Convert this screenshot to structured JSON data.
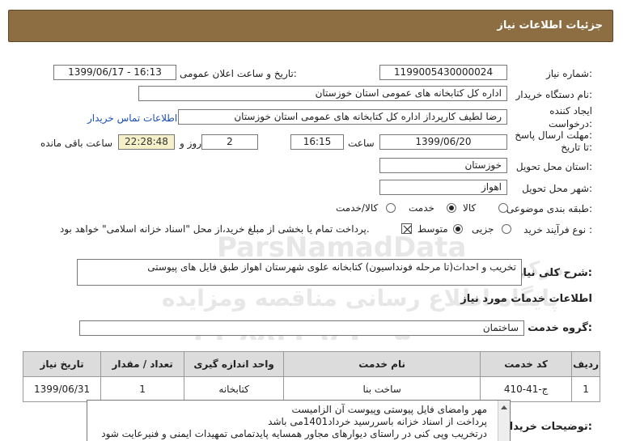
{
  "header": {
    "title": "جزئیات اطلاعات نیاز"
  },
  "fields": {
    "need_number_label": "شماره نیاز:",
    "need_number": "1199005430000024",
    "announce_label": "تاریخ و ساعت اعلان عمومی:",
    "announce_value": "1399/06/17 - 16:13",
    "buyer_label": "نام دستگاه خریدار:",
    "buyer_value": "اداره کل کتابخانه های عمومی استان خوزستان",
    "creator_label_1": "ایجاد کننده",
    "creator_label_2": "درخواست:",
    "creator_value": "رضا لطیف کارپرداز اداره کل کتابخانه های عمومی استان خوزستان",
    "contact_link": "اطلاعات تماس خریدار",
    "deadline_label_1": "مهلت ارسال پاسخ:",
    "deadline_label_2": "تا تاریخ:",
    "deadline_date": "1399/06/20",
    "time_label": "ساعت",
    "deadline_time": "16:15",
    "days_value": "2",
    "days_label": "روز و",
    "remaining_time": "22:28:48",
    "remaining_label": "ساعت باقی مانده",
    "province_label": "استان محل تحویل:",
    "province_value": "خوزستان",
    "city_label": "شهر محل تحویل:",
    "city_value": "اهواز",
    "category_label": "طبقه بندی موضوعی:",
    "category_options": [
      "کالا",
      "خدمت",
      "کالا/خدمت"
    ],
    "category_selected": "خدمت",
    "process_label": "نوع فرآیند خرید :",
    "process_options": [
      "جزیی",
      "متوسط"
    ],
    "process_selected": "متوسط",
    "payment_note": "پرداخت تمام یا بخشی از مبلغ خرید،از محل \"اسناد خزانه اسلامی\" خواهد بود."
  },
  "summary": {
    "label": "شرح کلی نیاز:",
    "value": "تخریب و احداث(تا مرحله فونداسیون) کتابخانه علوی شهرستان اهواز طبق فایل های پیوستی"
  },
  "services": {
    "section_title": "اطلاعات خدمات مورد نیاز",
    "group_label": "گروه خدمت:",
    "group_value": "ساختمان",
    "columns": [
      "ردیف",
      "کد خدمت",
      "نام خدمت",
      "واحد اندازه گیری",
      "تعداد / مقدار",
      "تاریخ نیاز"
    ],
    "rows": [
      [
        "1",
        "ج-41-410",
        "ساخت بنا",
        "کتابخانه",
        "1",
        "1399/06/31"
      ]
    ]
  },
  "buyer_notes": {
    "label": "توضیحات خریدار:",
    "lines": [
      "مهر وامضای فایل پیوستی وپیوست آن الزامیست",
      "پرداخت از اسناد خزانه باسررسید خرداد1401می باشد",
      "درتخریب وپی کنی در راستای دیوارهای مجاور همسایه پایدتمامی تمهیدات ایمنی و فنیرعایت شود"
    ]
  },
  "watermark": {
    "line1": "ParsNamadData",
    "line2": "مرکز فراوری اطلاعات پارس نماد داده",
    "line3": "پایگاه اطلاع رسانی مناقصه ومزایده",
    "line4": "۰۲۱-۸۸۳۴۹۶۷۰-۵"
  }
}
